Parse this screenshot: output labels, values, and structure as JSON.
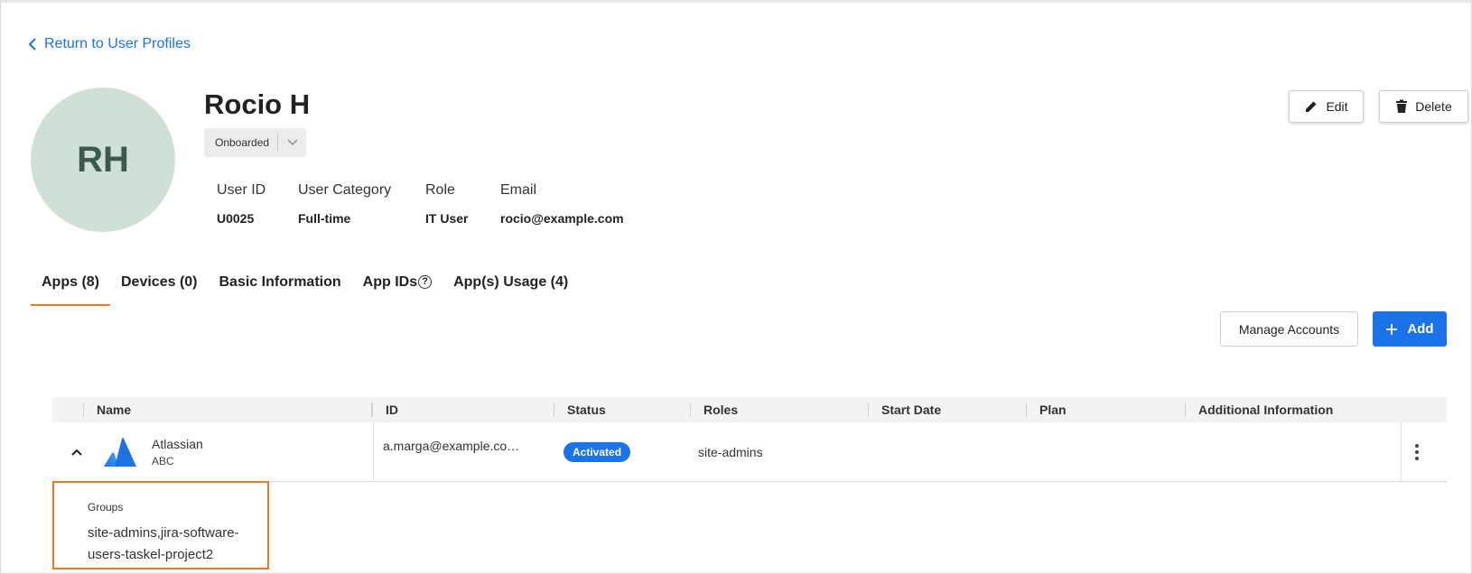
{
  "nav": {
    "back_label": "Return to User Profiles"
  },
  "user": {
    "initials": "RH",
    "name": "Rocio H",
    "status": "Onboarded",
    "fields": [
      {
        "label": "User ID",
        "value": "U0025"
      },
      {
        "label": "User Category",
        "value": "Full-time"
      },
      {
        "label": "Role",
        "value": "IT User"
      },
      {
        "label": "Email",
        "value": "rocio@example.com"
      }
    ]
  },
  "actions": {
    "edit_label": "Edit",
    "delete_label": "Delete"
  },
  "tabs": [
    {
      "label": "Apps (8)",
      "active": true
    },
    {
      "label": "Devices (0)"
    },
    {
      "label": "Basic Information"
    },
    {
      "label": "App IDs"
    },
    {
      "label": "App(s) Usage (4)"
    }
  ],
  "toolbar": {
    "manage_label": "Manage Accounts",
    "add_label": "Add"
  },
  "table": {
    "columns": [
      "Name",
      "ID",
      "Status",
      "Roles",
      "Start Date",
      "Plan",
      "Additional Information"
    ],
    "rows": [
      {
        "app_name": "Atlassian",
        "app_sub": "ABC",
        "id": "a.marga@example.co…",
        "status": "Activated",
        "roles": "site-admins",
        "start_date": "",
        "plan": "",
        "additional": ""
      }
    ]
  },
  "expanded": {
    "label": "Groups",
    "value": "site-admins,jira-software-users-taskel-project2"
  },
  "colors": {
    "primary": "#1a73e8",
    "accent": "#f07a24",
    "avatar_bg": "#cfe0d6"
  },
  "icons": [
    "chevron-left-icon",
    "chevron-down-icon",
    "pencil-icon",
    "trash-icon",
    "help-circle-icon",
    "plus-icon",
    "chevron-up-icon",
    "atlassian-logo-icon",
    "more-vertical-icon"
  ]
}
